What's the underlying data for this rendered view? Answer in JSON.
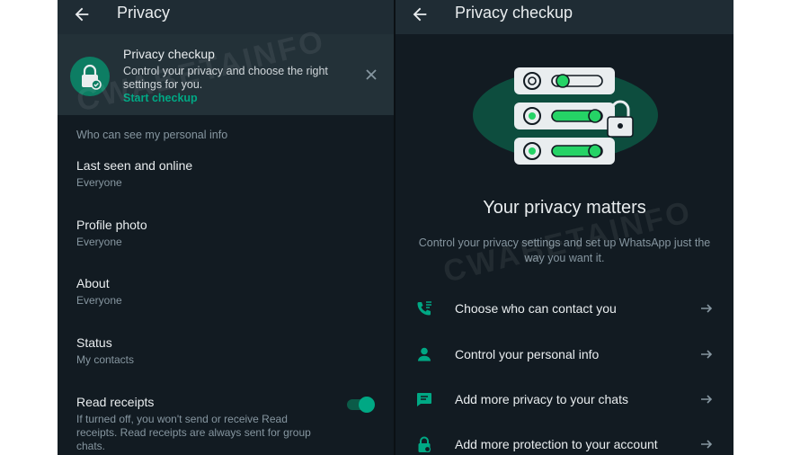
{
  "left_panel": {
    "title": "Privacy",
    "checkup_banner": {
      "title": "Privacy checkup",
      "description": "Control your privacy and choose the right settings for you.",
      "link": "Start checkup"
    },
    "section_label": "Who can see my personal info",
    "settings": [
      {
        "name": "Last seen and online",
        "value": "Everyone"
      },
      {
        "name": "Profile photo",
        "value": "Everyone"
      },
      {
        "name": "About",
        "value": "Everyone"
      },
      {
        "name": "Status",
        "value": "My contacts"
      },
      {
        "name": "Read receipts",
        "value": "If turned off, you won't send or receive Read receipts. Read receipts are always sent for group chats."
      }
    ],
    "read_receipts_enabled": true
  },
  "right_panel": {
    "title": "Privacy checkup",
    "heading": "Your privacy matters",
    "subtitle": "Control your privacy settings and set up WhatsApp just the way you want it.",
    "options": [
      {
        "label": "Choose who can contact you",
        "icon": "contact-phone-icon"
      },
      {
        "label": "Control your personal info",
        "icon": "person-icon"
      },
      {
        "label": "Add more privacy to your chats",
        "icon": "chat-icon"
      },
      {
        "label": "Add more protection to your account",
        "icon": "lock-icon"
      }
    ]
  },
  "watermark": "CWABETAINFO",
  "colors": {
    "background": "#121b22",
    "app_bar": "#1f2c34",
    "banner": "#233138",
    "accent": "#00a884",
    "primary_text": "#e9edef",
    "secondary_text": "#8696a0"
  }
}
